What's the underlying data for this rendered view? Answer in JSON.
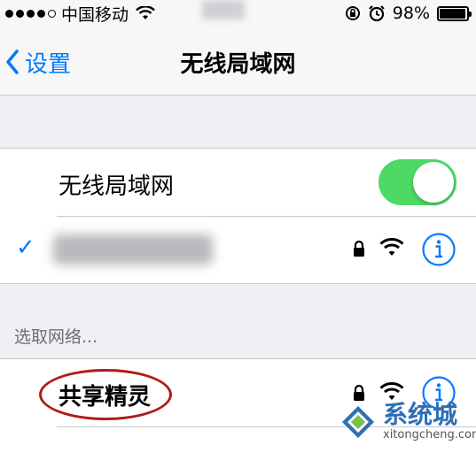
{
  "status_bar": {
    "carrier": "中国移动",
    "battery_percent": "98%",
    "battery_level": 0.98
  },
  "nav": {
    "back_label": "设置",
    "title": "无线局域网"
  },
  "wifi": {
    "toggle_label": "无线局域网",
    "enabled": true
  },
  "section_header": "选取网络...",
  "networks": [
    {
      "name": "共享精灵",
      "secured": true
    }
  ],
  "watermark": {
    "title": "系统城",
    "url": "xitongcheng.com"
  },
  "colors": {
    "accent": "#007aff",
    "toggle_on": "#4cd964",
    "annotation": "#b01a1a"
  }
}
